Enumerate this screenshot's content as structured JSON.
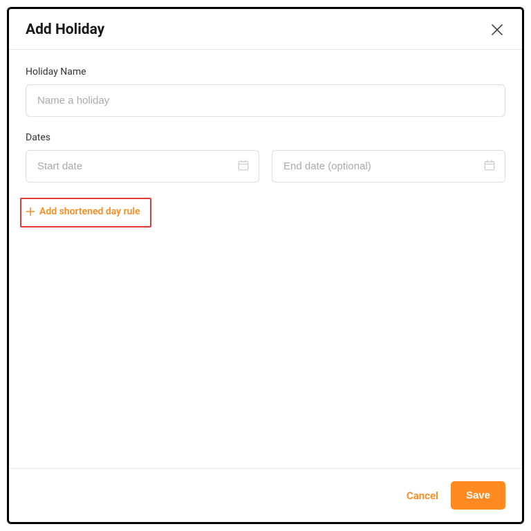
{
  "header": {
    "title": "Add Holiday"
  },
  "form": {
    "name": {
      "label": "Holiday Name",
      "placeholder": "Name a holiday",
      "value": ""
    },
    "dates": {
      "label": "Dates",
      "start": {
        "placeholder": "Start date",
        "value": ""
      },
      "end": {
        "placeholder": "End date (optional)",
        "value": ""
      }
    },
    "add_rule_label": "Add shortened day rule"
  },
  "footer": {
    "cancel_label": "Cancel",
    "save_label": "Save"
  }
}
